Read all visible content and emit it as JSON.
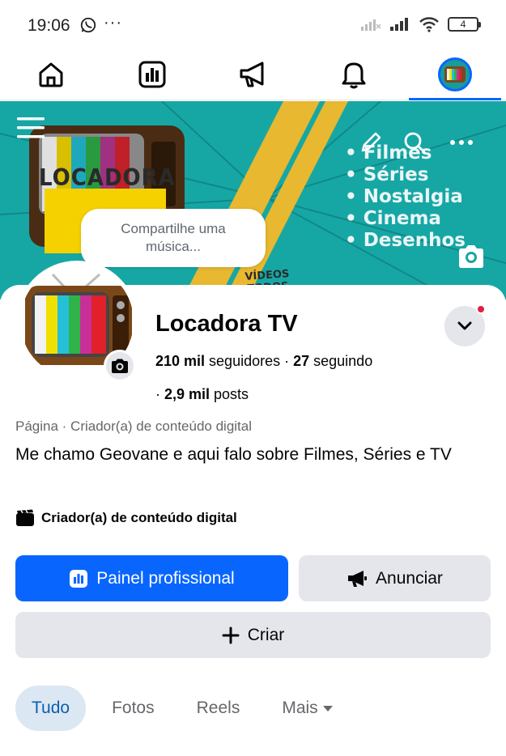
{
  "status_bar": {
    "time": "19:06",
    "dots": "···",
    "battery": "4"
  },
  "nav": {
    "items": [
      {
        "icon": "home-icon"
      },
      {
        "icon": "dashboard-icon"
      },
      {
        "icon": "megaphone-icon"
      },
      {
        "icon": "bell-icon"
      },
      {
        "icon": "profile-avatar"
      }
    ],
    "active_index": 4,
    "accent": "#0866ff"
  },
  "cover": {
    "brand": "LOCADORA",
    "tagline": "VÍDEOS TODOS OS DIAS",
    "list": [
      "Filmes",
      "Séries",
      "Nostalgia",
      "Cinema",
      "Desenhos"
    ],
    "music_prompt": "Compartilhe uma música..."
  },
  "profile": {
    "name": "Locadora TV",
    "followers_count": "210 mil",
    "followers_label": " seguidores · ",
    "following_count": "27",
    "following_label": " seguindo",
    "posts_prefix": "· ",
    "posts_count": "2,9 mil",
    "posts_label": " posts",
    "category": "Página · Criador(a) de conteúdo digital",
    "bio": "Me chamo Geovane e aqui falo sobre Filmes, Séries e TV",
    "creator_label": "Criador(a) de conteúdo digital"
  },
  "actions": {
    "dashboard": "Painel profissional",
    "advertise": "Anunciar",
    "create": "Criar"
  },
  "tabs": [
    {
      "label": "Tudo",
      "active": true
    },
    {
      "label": "Fotos",
      "active": false
    },
    {
      "label": "Reels",
      "active": false
    },
    {
      "label": "Mais",
      "active": false
    }
  ],
  "colors": {
    "primary": "#0866ff",
    "cover_teal": "#17a8a8",
    "notification": "#e41e3f"
  }
}
